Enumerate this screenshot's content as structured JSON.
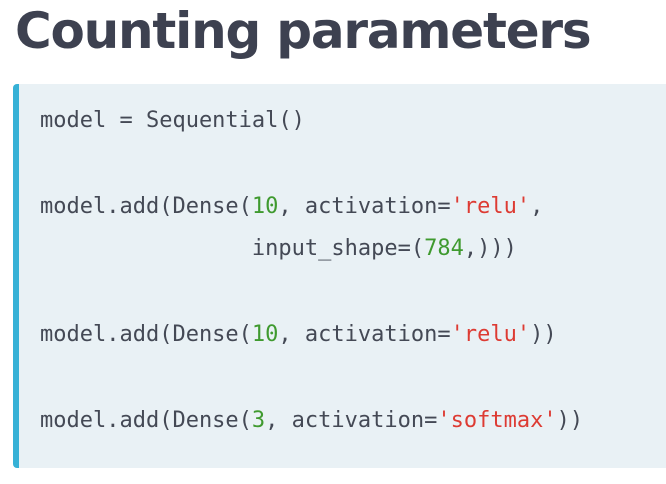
{
  "title": "Counting parameters",
  "colors": {
    "title_text": "#3d4150",
    "code_background": "#e9f1f5",
    "code_accent_bar": "#36b1d6",
    "code_text": "#444955",
    "number_literal": "#3f9a2f",
    "string_literal": "#dd3b33"
  },
  "code": {
    "line1": "model = Sequential()",
    "line2": {
      "prefix": "model.add(Dense(",
      "num": "10",
      "mid": ", activation=",
      "str": "'relu'",
      "suffix": ","
    },
    "line3": {
      "prefix": "                input_shape=(",
      "num": "784",
      "suffix": ",)))"
    },
    "line4": {
      "prefix": "model.add(Dense(",
      "num": "10",
      "mid": ", activation=",
      "str": "'relu'",
      "suffix": "))"
    },
    "line5": {
      "prefix": "model.add(Dense(",
      "num": "3",
      "mid": ", activation=",
      "str": "'softmax'",
      "suffix": "))"
    }
  }
}
